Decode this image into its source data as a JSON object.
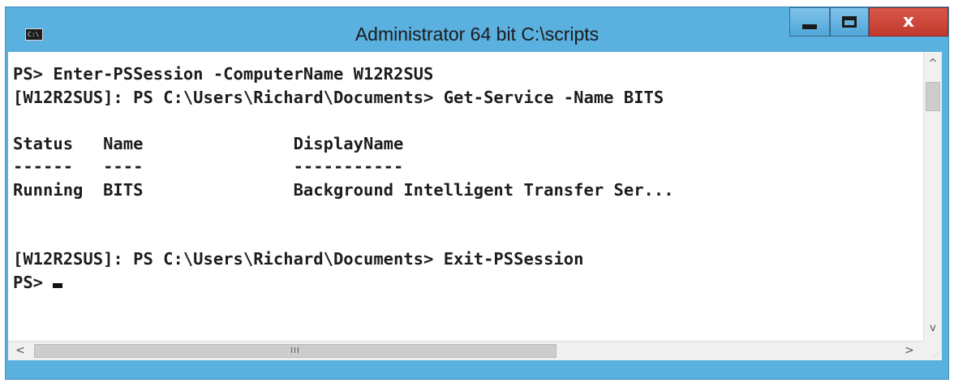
{
  "window": {
    "title": "Administrator 64 bit C:\\scripts",
    "accent_color": "#5ab0df",
    "close_color": "#c9463a",
    "icons": {
      "app": "console-icon",
      "minimize": "minimize-icon",
      "maximize": "maximize-icon",
      "close": "close-icon"
    },
    "app_icon_text": "C:\\",
    "close_glyph": "x"
  },
  "console": {
    "lines": [
      "PS> Enter-PSSession -ComputerName W12R2SUS",
      "[W12R2SUS]: PS C:\\Users\\Richard\\Documents> Get-Service -Name BITS",
      "",
      "Status   Name               DisplayName",
      "------   ----               -----------",
      "Running  BITS               Background Intelligent Transfer Ser...",
      "",
      "",
      "[W12R2SUS]: PS C:\\Users\\Richard\\Documents> Exit-PSSession"
    ],
    "prompt": "PS> "
  },
  "scrollbars": {
    "up_arrow": "^",
    "down_arrow": "v",
    "left_arrow": "<",
    "right_arrow": ">",
    "grip": "III"
  }
}
